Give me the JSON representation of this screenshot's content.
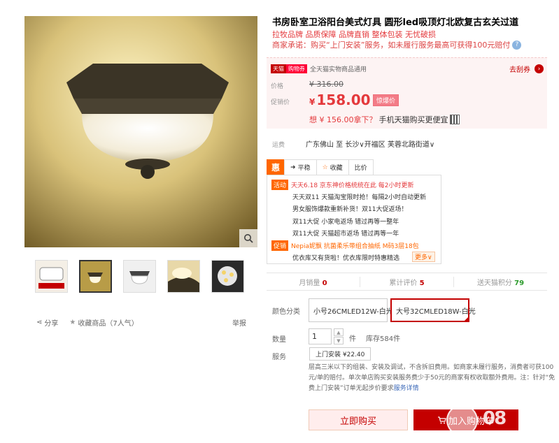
{
  "product": {
    "title": "书房卧室卫浴阳台美式灯具 圆形led吸顶灯北欧复古玄关过道",
    "subtitle": "拉牧品牌 品质保障 品牌直销 整体包装 无忧破损",
    "promise": "商家承诺：购买“上门安装”服务，如未履行服务最高可获得100元赔付",
    "promise_help": "?"
  },
  "price_box": {
    "tmall_tag": "天猫",
    "goods_tag": "购物券",
    "goods_text": "全天猫实物商品通用",
    "coupon_link": "去刮券",
    "price_label": "价格",
    "original_price": "¥ 316.00",
    "promo_label": "促销价",
    "currency": "¥",
    "promo_price": "158.00",
    "flash_tag": "惊爆价",
    "app_text_a": "想 ¥ 156.00拿下？",
    "app_text_b": "手机天猫购买更便宜"
  },
  "shipping": {
    "label": "运费",
    "text": "广东佛山 至 长沙∨开福区 芙蓉北路街道∨"
  },
  "tabs": {
    "hui": "惠",
    "pingwen": "平稳",
    "collect": "收藏",
    "compare": "比价"
  },
  "promos": [
    {
      "badge": "活动",
      "text": "天天6.18 京东神价格统统在此 每2小时更新"
    },
    {
      "text": "天天双11 天猫淘宝限时抢！每隔2小时自动更新"
    },
    {
      "text": "男女服饰爆款重新补货！双11大促返场！"
    },
    {
      "text": "双11大促 小家电返场 错过再等一整年"
    },
    {
      "text": "双11大促 天猫超市返场 错过再等一年"
    },
    {
      "badge": "促销",
      "text": "Nepia妮飘 抗菌柔乐带组合抽纸 M码3层18包"
    },
    {
      "text": "优衣库又有货啦！优衣库限时特惠精选"
    }
  ],
  "promo_more": "更多∨",
  "stats": {
    "sales_label": "月销量",
    "sales_value": "0",
    "reviews_label": "累计评价",
    "reviews_value": "5",
    "points_label": "送天猫积分",
    "points_value": "79"
  },
  "sku": {
    "label": "颜色分类",
    "options": [
      "小号26CMLED12W-白光",
      "大号32CMLED18W-白光"
    ],
    "selected": 1
  },
  "quantity": {
    "label": "数量",
    "value": "1",
    "unit": "件",
    "stock": "库存584件"
  },
  "service": {
    "label": "服务",
    "tag": "上门安装 ¥22.40",
    "desc": "层高三米以下的组装、安装及调试，不含拆旧费用。如商家未履行服务，消费者可获100元/单的赔付。单次单店购买安装服务费少于50元的商家有权收取额外费用。注：针对“免费上门安装”订单无起步价要求",
    "desc_link": "服务详情"
  },
  "actions": {
    "buy_now": "立即购买",
    "add_cart": "加入购物车"
  },
  "left": {
    "share": "分享",
    "collect": "收藏商品（7人气）",
    "report": "举报",
    "thumbs": [
      "thumb-1",
      "thumb-2",
      "thumb-3",
      "thumb-4",
      "thumb-5"
    ],
    "active_thumb": 1
  },
  "colors": {
    "accent": "#c40000",
    "price": "#e4393c",
    "tab_orange": "#ff6600",
    "reviews_green": "#2c9b2c"
  }
}
